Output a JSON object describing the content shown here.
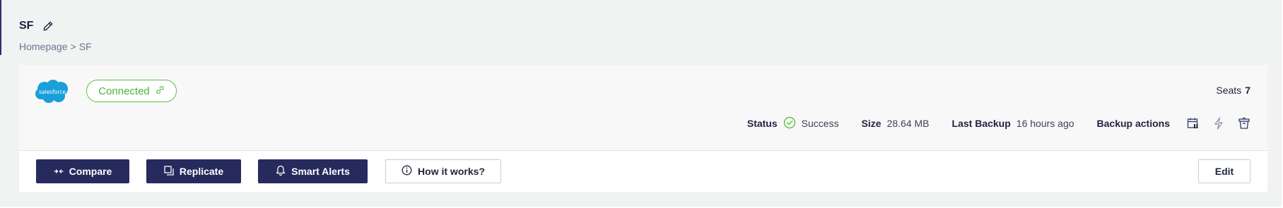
{
  "header": {
    "title": "SF",
    "edit_icon": "pencil-icon"
  },
  "breadcrumb": {
    "home": "Homepage",
    "separator": ">",
    "current": "SF"
  },
  "integration": {
    "logo_text": "salesforce",
    "status_pill": "Connected",
    "status_pill_icon": "link-icon",
    "seats_label": "Seats",
    "seats_value": "7"
  },
  "stats": {
    "status_label": "Status",
    "status_value": "Success",
    "status_icon": "check-circle-icon",
    "size_label": "Size",
    "size_value": "28.64 MB",
    "last_backup_label": "Last Backup",
    "last_backup_value": "16 hours ago",
    "backup_actions_label": "Backup actions",
    "action_icons": [
      "calendar-pause-icon",
      "lightning-icon",
      "trash-icon"
    ]
  },
  "toolbar": {
    "compare_label": "Compare",
    "replicate_label": "Replicate",
    "smart_alerts_label": "Smart Alerts",
    "how_it_works_label": "How it works?",
    "edit_label": "Edit"
  },
  "colors": {
    "primary": "#262a5c",
    "success": "#5cbf45",
    "salesforce": "#1a9fd9",
    "background": "#f1f2f2"
  }
}
